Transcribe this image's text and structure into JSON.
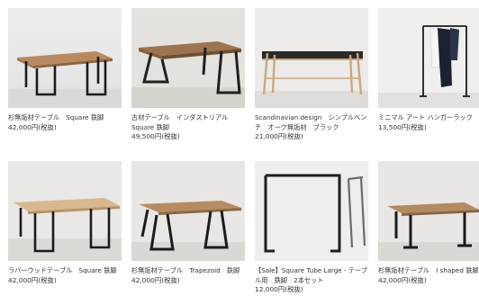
{
  "products": [
    {
      "name": "杉無垢材テーブル　Square 鉄脚",
      "price": "42,000円(税抜)",
      "image": "cedar-table-square-iron-legs"
    },
    {
      "name": "古材テーブル　インダストリアル Square 鉄脚",
      "price": "49,500円(税抜)",
      "image": "reclaimed-wood-table-industrial"
    },
    {
      "name": "Scandinavian design　シンプルベンチ　オーク無垢材　ブラック",
      "price": "21,000円(税抜)",
      "image": "oak-bench-black"
    },
    {
      "name": "ミニマル アート ハンガーラック",
      "price": "13,500円(税抜)",
      "image": "hanger-rack"
    },
    {
      "name": "ラバーウッドテーブル　Square 鉄脚",
      "price": "42,000円(税抜)",
      "image": "rubberwood-table-square"
    },
    {
      "name": "杉無垢材テーブル　Trapezoid　鉄脚",
      "price": "42,000円(税抜)",
      "image": "cedar-table-trapezoid"
    },
    {
      "name": "【Sale】Square Tube Large - テーブル用　鉄脚　2本セット",
      "price": "12,000円(税抜)",
      "image": "square-tube-legs"
    },
    {
      "name": "杉無垢材テーブル　I shaped 鉄脚",
      "price": "42,000円(税抜)",
      "image": "cedar-table-i-shaped"
    }
  ]
}
